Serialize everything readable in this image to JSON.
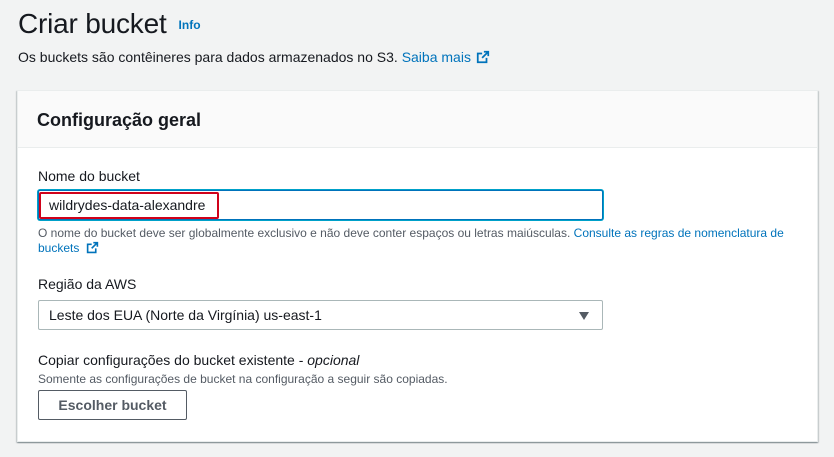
{
  "header": {
    "title": "Criar bucket",
    "info_label": "Info",
    "description": "Os buckets são contêineres para dados armazenados no S3.",
    "learn_more": "Saiba mais"
  },
  "panel": {
    "title": "Configuração geral",
    "bucket_name": {
      "label": "Nome do bucket",
      "value": "wildrydes-data-alexandre",
      "hint": "O nome do bucket deve ser globalmente exclusivo e não deve conter espaços ou letras maiúsculas.",
      "hint_link": "Consulte as regras de nomenclatura de buckets"
    },
    "region": {
      "label": "Região da AWS",
      "selected": "Leste dos EUA (Norte da Virgínia) us-east-1"
    },
    "copy_settings": {
      "label": "Copiar configurações do bucket existente - ",
      "optional": "opcional",
      "hint": "Somente as configurações de bucket na configuração a seguir são copiadas.",
      "button_label": "Escolher bucket"
    }
  },
  "colors": {
    "link": "#0073bb",
    "highlight": "#d0021b",
    "focus": "#00a1c9"
  },
  "icons": [
    "external-link-icon",
    "caret-down-icon"
  ]
}
